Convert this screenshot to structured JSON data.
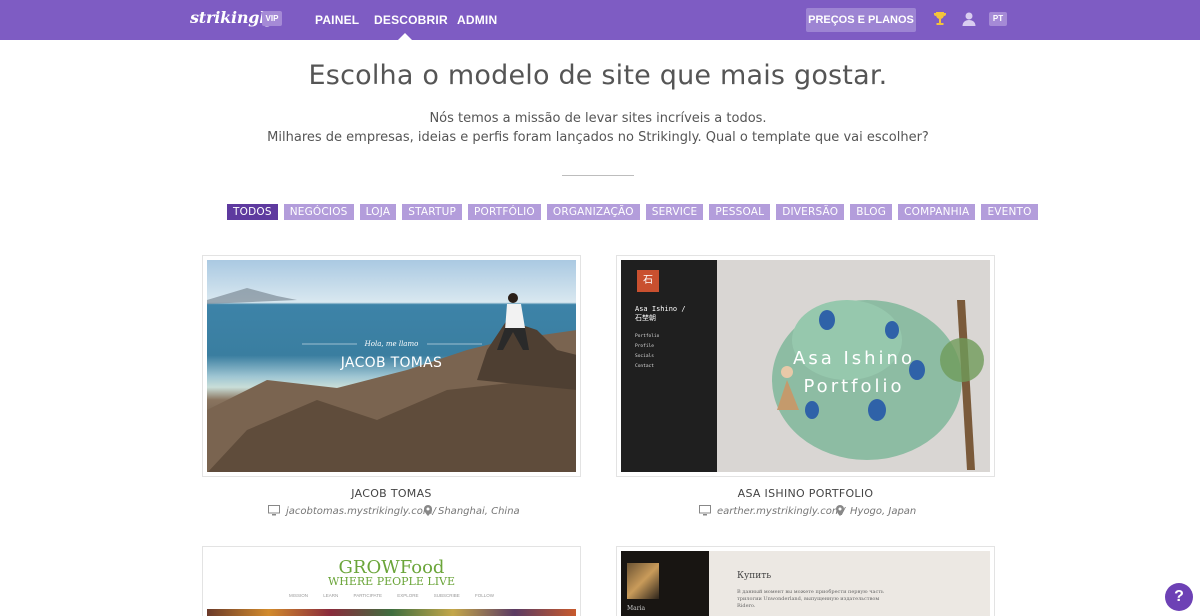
{
  "topbar": {
    "logo": "strikingly",
    "vip_badge": "VIP",
    "nav": [
      {
        "label": "PAINEL"
      },
      {
        "label": "DESCOBRIR",
        "active": true
      },
      {
        "label": "ADMIN"
      }
    ],
    "pricing_label": "PREÇOS E PLANOS",
    "language": "PT",
    "icons": [
      "trophy-icon",
      "user-icon"
    ]
  },
  "hero": {
    "title": "Escolha o modelo de site que mais gostar.",
    "subtitle_line1": "Nós temos a missão de levar sites incríveis a todos.",
    "subtitle_line2": "Milhares de empresas, ideias e perfis foram lançados no Strikingly. Qual o template que vai escolher?"
  },
  "filters": [
    {
      "label": "TODOS",
      "active": true
    },
    {
      "label": "NEGÓCIOS"
    },
    {
      "label": "LOJA"
    },
    {
      "label": "STARTUP"
    },
    {
      "label": "PORTFÓLIO"
    },
    {
      "label": "ORGANIZAÇÃO"
    },
    {
      "label": "SERVICE"
    },
    {
      "label": "PESSOAL"
    },
    {
      "label": "DIVERSÃO"
    },
    {
      "label": "BLOG"
    },
    {
      "label": "COMPANHIA"
    },
    {
      "label": "EVENTO"
    }
  ],
  "templates": [
    {
      "title": "JACOB TOMAS",
      "url": "jacobtomas.mystrikingly.com/",
      "location": "Shanghai, China",
      "preview_subtitle": "Hola, me llamo",
      "preview_title": "JACOB TOMAS"
    },
    {
      "title": "ASA ISHINO PORTFOLIO",
      "url": "earther.mystrikingly.com/",
      "location": "Hyogo, Japan",
      "preview_name": "Asa Ishino /",
      "preview_name2": "石埜朝",
      "preview_menu": [
        "Portfolio",
        "Profile",
        "Socials",
        "Contact"
      ],
      "preview_title_line1": "Asa Ishino",
      "preview_title_line2": "Portfolio",
      "seal": "石"
    },
    {
      "preview_logo": "GROWFood",
      "preview_tagline": "WHERE PEOPLE LIVE",
      "preview_nav": "MISSION LEARN PARTICIPATE EXPLORE SUBSCRIBE FOLLOW"
    },
    {
      "preview_heading": "Купить",
      "preview_text": "В данный момент вы можете приобрести первую часть трилогии Unwonderland, выпущенную издательством Ridero.",
      "preview_name": "Maria"
    }
  ],
  "help_label": "?"
}
